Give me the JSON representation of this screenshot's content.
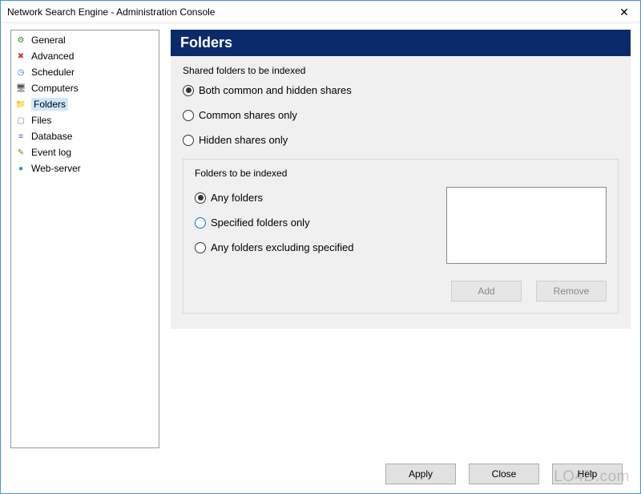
{
  "window": {
    "title": "Network Search Engine - Administration Console",
    "close_glyph": "✕"
  },
  "sidebar": {
    "items": [
      {
        "label": "General",
        "icon": "⚙",
        "icon_color": "#3a8a3a",
        "selected": false,
        "name": "sidebar-item-general"
      },
      {
        "label": "Advanced",
        "icon": "✖",
        "icon_color": "#c04040",
        "selected": false,
        "name": "sidebar-item-advanced"
      },
      {
        "label": "Scheduler",
        "icon": "◷",
        "icon_color": "#4070c0",
        "selected": false,
        "name": "sidebar-item-scheduler"
      },
      {
        "label": "Computers",
        "icon": "🖥",
        "icon_color": "#555",
        "selected": false,
        "name": "sidebar-item-computers"
      },
      {
        "label": "Folders",
        "icon": "📁",
        "icon_color": "#d9a000",
        "selected": true,
        "name": "sidebar-item-folders"
      },
      {
        "label": "Files",
        "icon": "▢",
        "icon_color": "#888",
        "selected": false,
        "name": "sidebar-item-files"
      },
      {
        "label": "Database",
        "icon": "≡",
        "icon_color": "#5050b0",
        "selected": false,
        "name": "sidebar-item-database"
      },
      {
        "label": "Event log",
        "icon": "✎",
        "icon_color": "#808000",
        "selected": false,
        "name": "sidebar-item-eventlog"
      },
      {
        "label": "Web-server",
        "icon": "●",
        "icon_color": "#1e90ff",
        "selected": false,
        "name": "sidebar-item-webserver"
      }
    ]
  },
  "page": {
    "title": "Folders",
    "shared_group_label": "Shared folders to be indexed",
    "shared_options": [
      {
        "label": "Both common and hidden shares",
        "checked": true,
        "name": "radio-both-shares"
      },
      {
        "label": "Common shares only",
        "checked": false,
        "name": "radio-common-only"
      },
      {
        "label": "Hidden shares only",
        "checked": false,
        "name": "radio-hidden-only"
      }
    ],
    "folders_group_label": "Folders to be indexed",
    "folders_options": [
      {
        "label": "Any folders",
        "checked": true,
        "highlight": false,
        "name": "radio-any-folders"
      },
      {
        "label": "Specified folders only",
        "checked": false,
        "highlight": true,
        "name": "radio-specified-only"
      },
      {
        "label": "Any folders excluding specified",
        "checked": false,
        "highlight": false,
        "name": "radio-excluding-specified"
      }
    ],
    "add_label": "Add",
    "remove_label": "Remove"
  },
  "footer": {
    "apply": "Apply",
    "close": "Close",
    "help": "Help"
  },
  "watermark": "LO4D.com"
}
